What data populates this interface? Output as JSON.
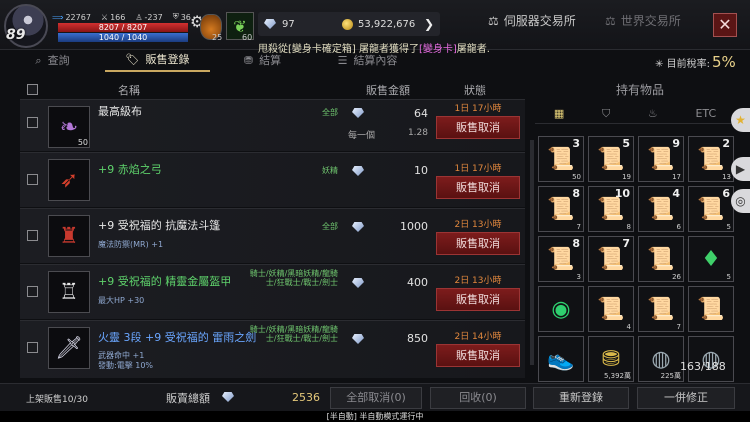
{
  "player": {
    "level": "89",
    "stat1": "22767",
    "stat2": "166",
    "stat3": "-237",
    "stat4": "36",
    "hp": "8207 / 8207",
    "mp": "1040 / 1040",
    "potion_count": "25",
    "leaf_count": "60"
  },
  "currency": {
    "diamonds": "97",
    "gold": "53,922,676"
  },
  "header": {
    "server_exchange": "伺服器交易所",
    "world_exchange": "世界交易所",
    "close": "✕",
    "notice_pre": "甩殺從[變身卡確定箱] 屠龍者獲得了",
    "notice_item": "[變身卡]",
    "notice_post": "屠龍者.",
    "tax_label": "目前稅率:",
    "tax_value": "5%"
  },
  "tabs": [
    "查詢",
    "販售登錄",
    "結算",
    "結算內容"
  ],
  "columns": {
    "name": "名稱",
    "amount": "販售金額",
    "status": "狀態"
  },
  "listings": [
    {
      "name": "最高級布",
      "qty": "50",
      "class": "全部",
      "price": "64",
      "each_label": "每一個",
      "each_price": "1.28",
      "time": "1日 17小時",
      "cancel": "販售取消",
      "sub1": "",
      "sub2": ""
    },
    {
      "name": "+9 赤焰之弓",
      "qty": "",
      "class": "妖精",
      "price": "10",
      "each_label": "",
      "each_price": "",
      "time": "1日 17小時",
      "cancel": "販售取消",
      "sub1": "",
      "sub2": ""
    },
    {
      "name": "+9 受祝福的 抗魔法斗篷",
      "qty": "",
      "class": "全部",
      "price": "1000",
      "each_label": "",
      "each_price": "",
      "time": "2日 13小時",
      "cancel": "販售取消",
      "sub1": "魔法防禦(MR) +1",
      "sub2": ""
    },
    {
      "name": "+9 受祝福的 精靈金屬盔甲",
      "qty": "",
      "class": "騎士/妖精/黑暗妖精/龍騎士/狂戰士/戰士/劍士",
      "price": "400",
      "each_label": "",
      "each_price": "",
      "time": "2日 13小時",
      "cancel": "販售取消",
      "sub1": "最大HP +30",
      "sub2": ""
    },
    {
      "name": "火靈 3段 +9 受祝福的 雷雨之劍",
      "qty": "",
      "class": "騎士/妖精/黑暗妖精/龍騎士/狂戰士/戰士/劍士",
      "price": "850",
      "each_label": "",
      "each_price": "",
      "time": "2日 14小時",
      "cancel": "販售取消",
      "sub1": "武器命中 +1",
      "sub2": "發動:電擊 10%"
    }
  ],
  "inventory": {
    "title": "持有物品",
    "etc": "ETC",
    "capacity": "163/188",
    "cells": [
      {
        "icon": "scroll",
        "top": "3",
        "bottom": "50"
      },
      {
        "icon": "scroll",
        "top": "5",
        "bottom": "19"
      },
      {
        "icon": "scroll",
        "top": "9",
        "bottom": "17"
      },
      {
        "icon": "scroll",
        "top": "2",
        "bottom": "13"
      },
      {
        "icon": "scroll",
        "top": "8",
        "bottom": "7"
      },
      {
        "icon": "scroll",
        "top": "10",
        "bottom": "8"
      },
      {
        "icon": "scroll",
        "top": "4",
        "bottom": "6"
      },
      {
        "icon": "scroll",
        "top": "6",
        "bottom": "5"
      },
      {
        "icon": "scroll",
        "top": "8",
        "bottom": "3"
      },
      {
        "icon": "scroll",
        "top": "7",
        "bottom": ""
      },
      {
        "icon": "scroll",
        "top": "",
        "bottom": "26"
      },
      {
        "icon": "gem",
        "top": "",
        "bottom": "5"
      },
      {
        "icon": "orb",
        "top": "",
        "bottom": ""
      },
      {
        "icon": "scroll",
        "top": "",
        "bottom": "4"
      },
      {
        "icon": "scroll",
        "top": "",
        "bottom": "7"
      },
      {
        "icon": "scroll",
        "top": "",
        "bottom": ""
      },
      {
        "icon": "shoes",
        "top": "",
        "bottom": ""
      },
      {
        "icon": "coins",
        "top": "",
        "bottom": "5,392萬"
      },
      {
        "icon": "coin",
        "top": "",
        "bottom": "225萬"
      },
      {
        "icon": "coin",
        "top": "",
        "bottom": ""
      }
    ]
  },
  "footer": {
    "listed": "上架販售10/30",
    "total_label": "販賣總額",
    "total_value": "2536",
    "cancel_all": "全部取消(0)",
    "collect": "回收(0)",
    "relist": "重新登錄",
    "fix_all": "一併修正"
  },
  "status_line": "[半自動] 半自動模式運行中"
}
